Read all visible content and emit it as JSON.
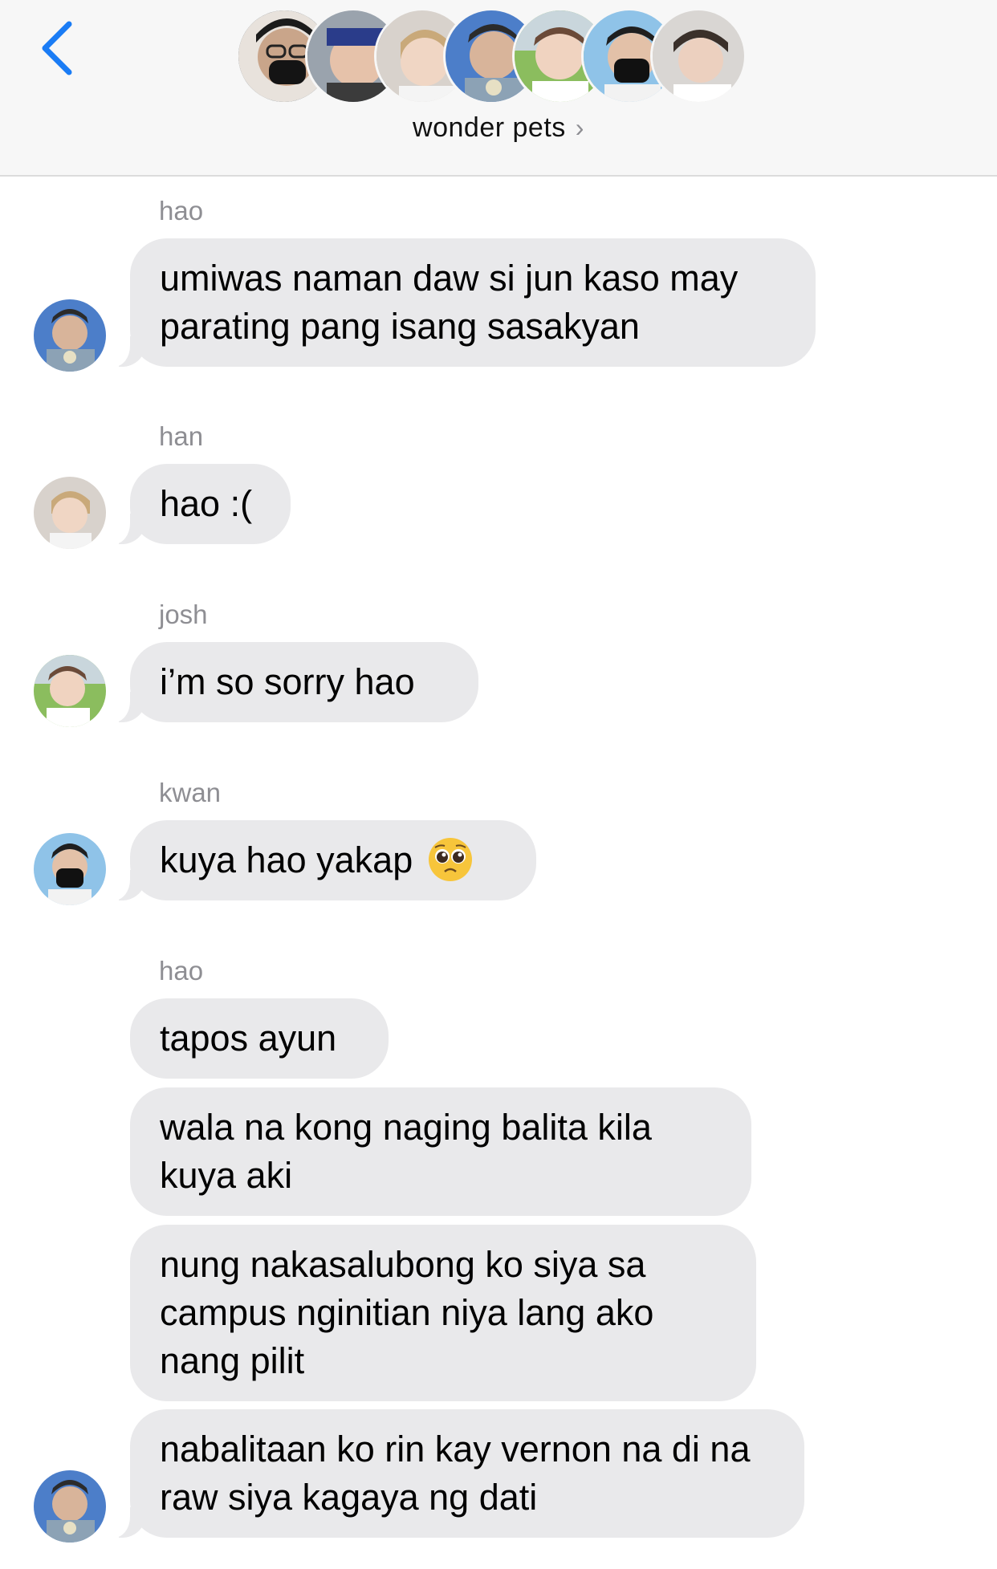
{
  "header": {
    "title": "wonder pets",
    "back_icon": "chevron-left-icon",
    "accent_color": "#1a7cf5",
    "member_avatar_count": 7
  },
  "messages": [
    {
      "sender": "hao",
      "text": "umiwas naman daw si jun kaso may parating pang isang sasakyan",
      "avatar": "hao"
    },
    {
      "sender": "han",
      "text": "hao :(",
      "avatar": "han"
    },
    {
      "sender": "josh",
      "text": "i’m so sorry hao",
      "avatar": "josh"
    },
    {
      "sender": "kwan",
      "text": "kuya hao yakap",
      "emoji": "pleading-face-emoji",
      "avatar": "kwan"
    },
    {
      "sender": "hao",
      "texts": [
        "tapos ayun",
        "wala na kong naging balita kila kuya aki",
        "nung nakasalubong ko siya sa campus nginitian niya lang ako nang pilit",
        "nabalitaan ko rin kay vernon na di na raw siya kagaya ng dati"
      ],
      "avatar": "hao"
    }
  ],
  "colors": {
    "bubble": "#e9e9eb",
    "header_bg": "#f7f7f7",
    "sender_label": "#8e8e93"
  }
}
